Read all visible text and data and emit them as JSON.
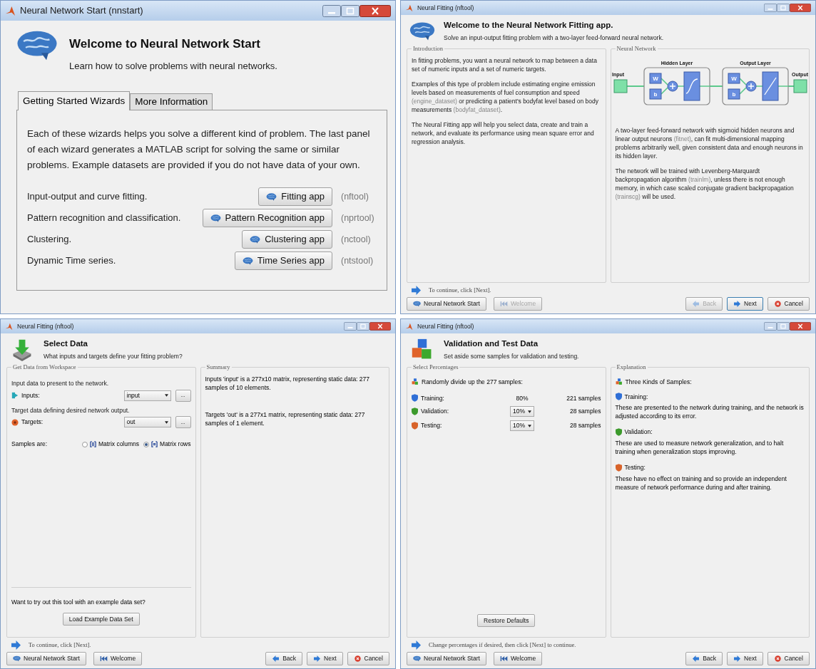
{
  "windows": [
    {
      "kind": "start",
      "title": "Neural Network Start (nnstart)",
      "heading": "Welcome to Neural Network Start",
      "subheading": "Learn how to solve problems with neural networks.",
      "tabs": [
        {
          "label": "Getting Started Wizards",
          "selected": true
        },
        {
          "label": "More Information",
          "selected": false
        }
      ],
      "description": "Each of these wizards helps you solve a different kind of problem. The last panel of each wizard generates a MATLAB script for solving the same or similar problems. Example datasets are provided if you do not have data of your own.",
      "wizards": [
        {
          "label": "Input-output and curve fitting.",
          "button": "Fitting app",
          "tool": "(nftool)"
        },
        {
          "label": "Pattern recognition and classification.",
          "button": "Pattern Recognition app",
          "tool": "(nprtool)"
        },
        {
          "label": "Clustering.",
          "button": "Clustering app",
          "tool": "(nctool)"
        },
        {
          "label": "Dynamic Time series.",
          "button": "Time Series app",
          "tool": "(ntstool)"
        }
      ]
    },
    {
      "kind": "intro",
      "title": "Neural Fitting (nftool)",
      "heading": "Welcome to the Neural Network Fitting app.",
      "subheading": "Solve an input-output fitting problem with a two-layer feed-forward neural network.",
      "left_panel": {
        "title": "Introduction",
        "paragraphs": [
          {
            "parts": [
              {
                "kind": "text",
                "text": "In fitting problems, you want a neural network to map between a data set of numeric inputs and a set of numeric targets."
              }
            ]
          },
          {
            "parts": [
              {
                "kind": "text",
                "text": "Examples of this type of problem include estimating engine emission levels based on measurements of fuel consumption and speed "
              },
              {
                "kind": "link",
                "text": "(engine_dataset)"
              },
              {
                "kind": "text",
                "text": " or predicting a patient's bodyfat level based on body measurements "
              },
              {
                "kind": "link",
                "text": "(bodyfat_dataset)"
              },
              {
                "kind": "text",
                "text": "."
              }
            ]
          },
          {
            "parts": [
              {
                "kind": "text",
                "text": "The Neural Fitting app will help you select data, create and train a network, and evaluate its performance using mean square error and regression analysis."
              }
            ]
          }
        ]
      },
      "right_panel": {
        "title": "Neural Network",
        "diagram": {
          "input": "Input",
          "output": "Output",
          "layers": [
            {
              "title": "Hidden Layer",
              "weight": "W",
              "bias": "b",
              "kind": "sigmoid"
            },
            {
              "title": "Output Layer",
              "weight": "W",
              "bias": "b",
              "kind": "linear"
            }
          ]
        },
        "paragraphs": [
          {
            "parts": [
              {
                "kind": "text",
                "text": "A two-layer feed-forward network with sigmoid hidden neurons and linear output neurons "
              },
              {
                "kind": "link",
                "text": "(fitnet)"
              },
              {
                "kind": "text",
                "text": ", can fit multi-dimensional mapping problems arbitrarily well, given consistent data and enough neurons in its hidden layer."
              }
            ]
          },
          {
            "parts": [
              {
                "kind": "text",
                "text": "The network will be trained with Levenberg-Marquardt backpropagation algorithm "
              },
              {
                "kind": "link",
                "text": "(trainlm)"
              },
              {
                "kind": "text",
                "text": ", unless there is not enough memory, in which case scaled conjugate gradient backpropagation "
              },
              {
                "kind": "link",
                "text": "(trainscg)"
              },
              {
                "kind": "text",
                "text": " will be used."
              }
            ]
          }
        ]
      },
      "hint": "To continue, click [Next].",
      "left_buttons": [
        {
          "label": "Neural Network Start",
          "kind": "start",
          "disabled": false,
          "focused": false
        },
        {
          "label": "Welcome",
          "kind": "welcome",
          "disabled": true,
          "focused": false
        }
      ],
      "right_buttons": [
        {
          "label": "Back",
          "kind": "back",
          "disabled": true,
          "focused": false
        },
        {
          "label": "Next",
          "kind": "next",
          "disabled": false,
          "focused": true
        },
        {
          "label": "Cancel",
          "kind": "cancel",
          "disabled": false,
          "focused": false
        }
      ]
    },
    {
      "kind": "select_data",
      "title": "Neural Fitting (nftool)",
      "heading": "Select Data",
      "subheading": "What inputs and targets define your fitting problem?",
      "left_panel": {
        "title": "Get Data from Workspace",
        "fields": [
          {
            "kind": "input",
            "prompt": "Input data to present to the network.",
            "label": "Inputs:",
            "value": "input",
            "browse": "..."
          },
          {
            "kind": "target",
            "prompt": "Target data defining desired network output.",
            "label": "Targets:",
            "value": "out",
            "browse": "..."
          }
        ],
        "samples_label": "Samples are:",
        "sample_options": [
          {
            "label": "Matrix columns",
            "kind": "columns",
            "selected": false
          },
          {
            "label": "Matrix rows",
            "kind": "rows",
            "selected": true
          }
        ],
        "example_prompt": "Want to try out this tool with an example data set?",
        "example_button": "Load Example Data Set"
      },
      "right_panel": {
        "title": "Summary",
        "paragraphs": [
          "Inputs 'input' is a 277x10 matrix, representing static data: 277 samples of 10 elements.",
          "Targets 'out' is a 277x1 matrix, representing static data: 277 samples of 1 element."
        ]
      },
      "hint": "To continue, click [Next].",
      "left_buttons": [
        {
          "label": "Neural Network Start",
          "kind": "start",
          "disabled": false,
          "focused": false
        },
        {
          "label": "Welcome",
          "kind": "welcome",
          "disabled": false,
          "focused": false
        }
      ],
      "right_buttons": [
        {
          "label": "Back",
          "kind": "back",
          "disabled": false,
          "focused": false
        },
        {
          "label": "Next",
          "kind": "next",
          "disabled": false,
          "focused": false
        },
        {
          "label": "Cancel",
          "kind": "cancel",
          "disabled": false,
          "focused": false
        }
      ]
    },
    {
      "kind": "divide",
      "title": "Neural Fitting (nftool)",
      "heading": "Validation and Test Data",
      "subheading": "Set aside some samples for validation and testing.",
      "left_panel": {
        "title": "Select Percentages",
        "intro": "Randomly divide up the 277 samples:",
        "rows": [
          {
            "label": "Training:",
            "percent": "80%",
            "editable": false,
            "samples": "221 samples",
            "color": "#2f6fd6"
          },
          {
            "label": "Validation:",
            "percent": "10%",
            "editable": true,
            "samples": "28 samples",
            "color": "#3c9a2c"
          },
          {
            "label": "Testing:",
            "percent": "10%",
            "editable": true,
            "samples": "28 samples",
            "color": "#d8632a"
          }
        ],
        "button": "Restore Defaults"
      },
      "right_panel": {
        "title": "Explanation",
        "intro": "Three Kinds of Samples:",
        "items": [
          {
            "title": "Training:",
            "text": "These are presented to the network during training, and the network is adjusted according to its error.",
            "color": "#2f6fd6"
          },
          {
            "title": "Validation:",
            "text": "These are used to measure network generalization, and to halt training when generalization stops improving.",
            "color": "#3c9a2c"
          },
          {
            "title": "Testing:",
            "text": "These have no effect on training and so provide an independent measure of network performance during and after training.",
            "color": "#d8632a"
          }
        ]
      },
      "hint": "Change percentages if desired, then click [Next] to continue.",
      "left_buttons": [
        {
          "label": "Neural Network Start",
          "kind": "start",
          "disabled": false,
          "focused": false
        },
        {
          "label": "Welcome",
          "kind": "welcome",
          "disabled": false,
          "focused": false
        }
      ],
      "right_buttons": [
        {
          "label": "Back",
          "kind": "back",
          "disabled": false,
          "focused": false
        },
        {
          "label": "Next",
          "kind": "next",
          "disabled": false,
          "focused": false
        },
        {
          "label": "Cancel",
          "kind": "cancel",
          "disabled": false,
          "focused": false
        }
      ]
    }
  ]
}
